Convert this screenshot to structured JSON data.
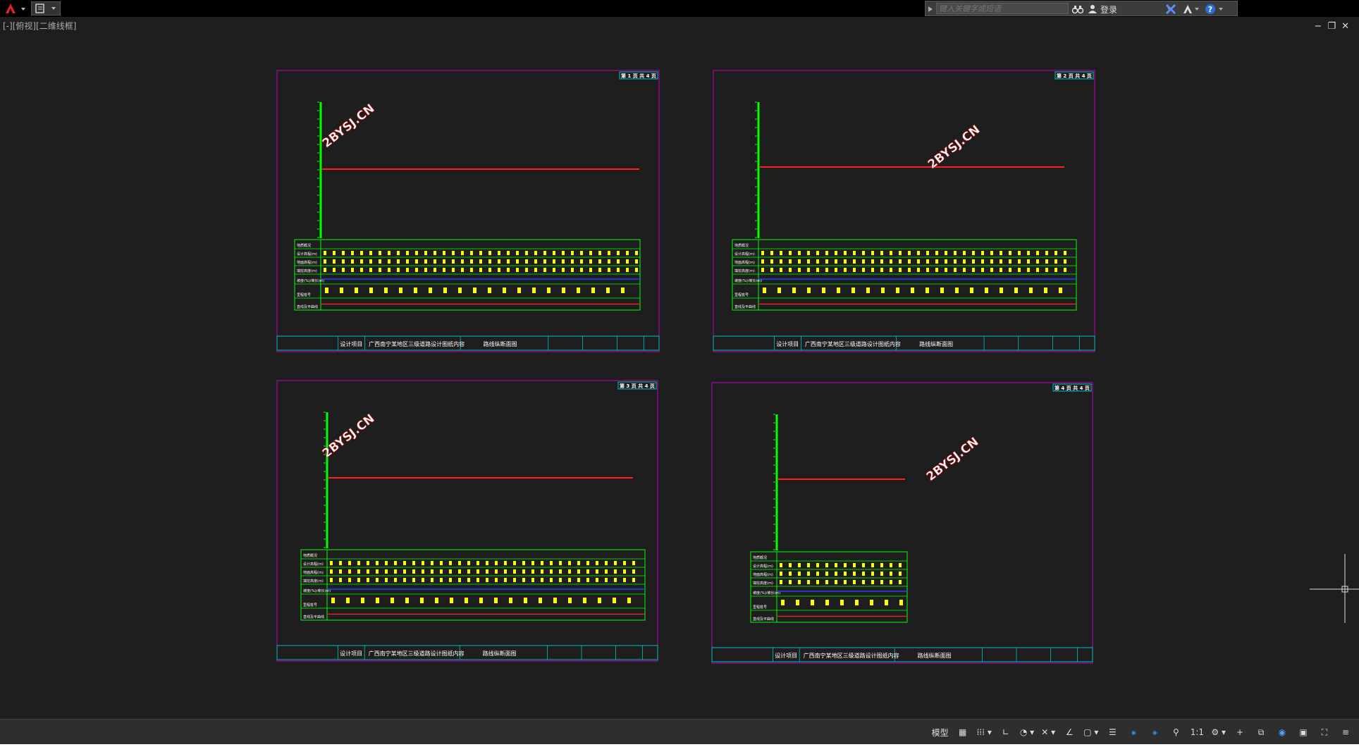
{
  "titlebar": {
    "search_placeholder": "键入关键字或短语",
    "login_label": "登录",
    "help_label": "?"
  },
  "viewport_label": "[-][俯视][二维线框]",
  "window_controls": {
    "minimize": "−",
    "restore": "❐",
    "close": "✕"
  },
  "watermark": "2BYSJ.CN",
  "sheets": [
    {
      "page": "第 1 页 共 4 页",
      "design_item_label": "设计项目",
      "project": "广西南宁某地区三级道路设计图纸内容",
      "drawing_title": "路线纵断面图"
    },
    {
      "page": "第 2 页 共 4 页",
      "design_item_label": "设计项目",
      "project": "广西南宁某地区三级道路设计图纸内容",
      "drawing_title": "路线纵断面图"
    },
    {
      "page": "第 3 页 共 4 页",
      "design_item_label": "设计项目",
      "project": "广西南宁某地区三级道路设计图纸内容",
      "drawing_title": "路线纵断面图"
    },
    {
      "page": "第 4 页 共 4 页",
      "design_item_label": "设计项目",
      "project": "广西南宁某地区三级道路设计图纸内容",
      "drawing_title": "路线纵断面图"
    }
  ],
  "row_labels": [
    "地质概况",
    "设计高程(m)",
    "地面高程(m)",
    "填挖高度(m)",
    "坡度(%)/坡长(m)",
    "里程桩号",
    "直线及平曲线"
  ],
  "statusbar": {
    "model_label": "模型",
    "scale_label": "1:1",
    "items": [
      "grid-icon",
      "snap-icon",
      "ortho-icon",
      "polar-icon",
      "osnap-icon",
      "otrack-icon",
      "lineweight-icon",
      "annotation-icon",
      "workspace-icon",
      "isolate-icon",
      "hardware-icon",
      "fullscreen-icon",
      "customize-icon"
    ]
  },
  "colors": {
    "background": "#1e1e1e",
    "frame": "#c000c0",
    "table_green": "#00ff00",
    "table_cyan": "#00c0c0",
    "profile_red": "#ff2020",
    "text_yellow": "#ffff00",
    "slope_blue": "#2040ff"
  }
}
